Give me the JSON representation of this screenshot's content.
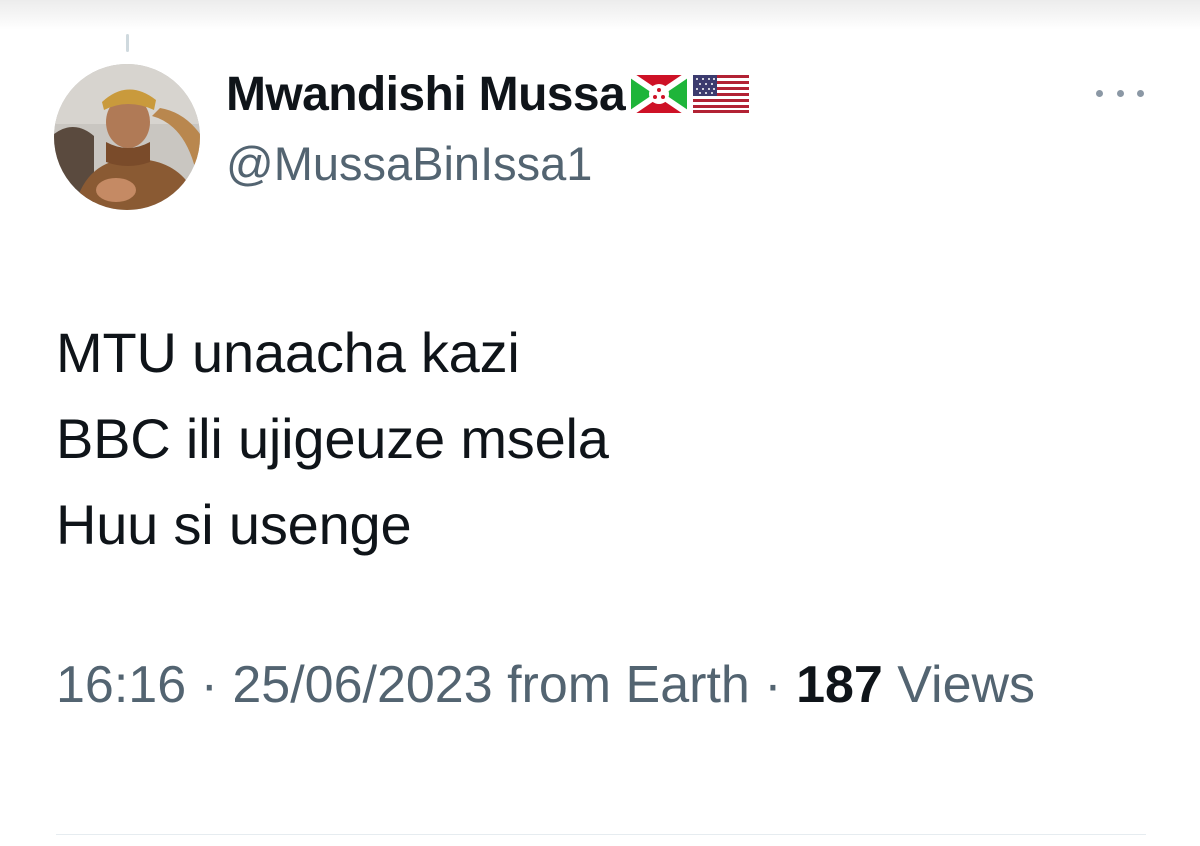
{
  "author": {
    "display_name": "Mwandishi Mussa",
    "flags": [
      "burundi-flag-icon",
      "us-flag-icon"
    ],
    "handle": "@MussaBinIssa1",
    "avatar": "profile-photo"
  },
  "menu": {
    "icon": "more-options-icon"
  },
  "tweet": {
    "lines": [
      "MTU unaacha kazi",
      "BBC ili ujigeuze msela",
      "Huu si usenge"
    ]
  },
  "meta": {
    "time": "16:16",
    "separator": "·",
    "date": "25/06/2023",
    "source": "from Earth",
    "views_count": "187",
    "views_label": "Views"
  },
  "colors": {
    "text_primary": "#0f1419",
    "text_secondary": "#536471",
    "divider": "#e6ecf0"
  }
}
